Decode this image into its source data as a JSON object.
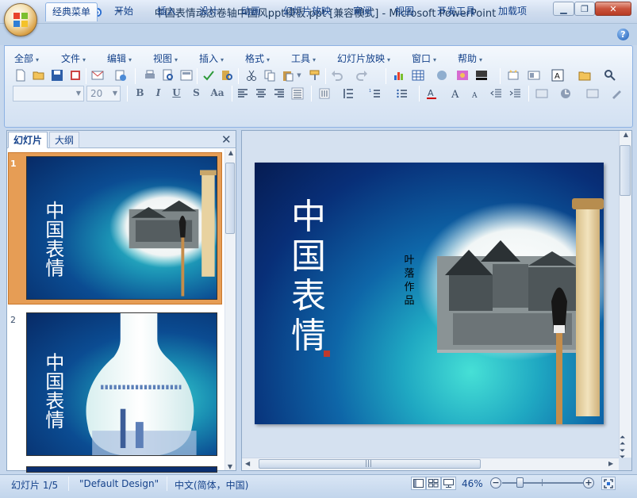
{
  "window": {
    "title": "中国表情动态卷轴中国风ppt模板.ppt [兼容模式] - Microsoft PowerPoint"
  },
  "ribbon_tabs": [
    "经典菜单",
    "开始",
    "插入",
    "设计",
    "动画",
    "幻灯片放映",
    "审阅",
    "视图",
    "开发工具",
    "加载项"
  ],
  "active_tab": "经典菜单",
  "classic_menu": [
    "全部",
    "文件",
    "编辑",
    "视图",
    "插入",
    "格式",
    "工具",
    "幻灯片放映",
    "窗口",
    "帮助"
  ],
  "font_size_value": "20",
  "format_buttons": [
    "B",
    "I",
    "U",
    "S",
    "Aa"
  ],
  "left_pane": {
    "tabs": [
      "幻灯片",
      "大纲"
    ],
    "active_tab": "幻灯片",
    "slide_numbers": [
      "1",
      "2"
    ]
  },
  "slide": {
    "calligraphy_title": "中国表情",
    "author_text": "叶落作品"
  },
  "status_bar": {
    "slide_info": "幻灯片 1/5",
    "design": "\"Default Design\"",
    "language": "中文(简体，中国)",
    "zoom": "46%"
  },
  "icons": {
    "office_button": "office-logo-icon",
    "qat": [
      "save-icon",
      "undo-icon",
      "redo-icon",
      "customize-qat-icon"
    ],
    "window": [
      "minimize-icon",
      "maximize-icon",
      "close-icon"
    ]
  },
  "colors": {
    "accent": "#15428b",
    "selected_thumb": "#e69d55",
    "slide_bg": "#0b4c92"
  }
}
